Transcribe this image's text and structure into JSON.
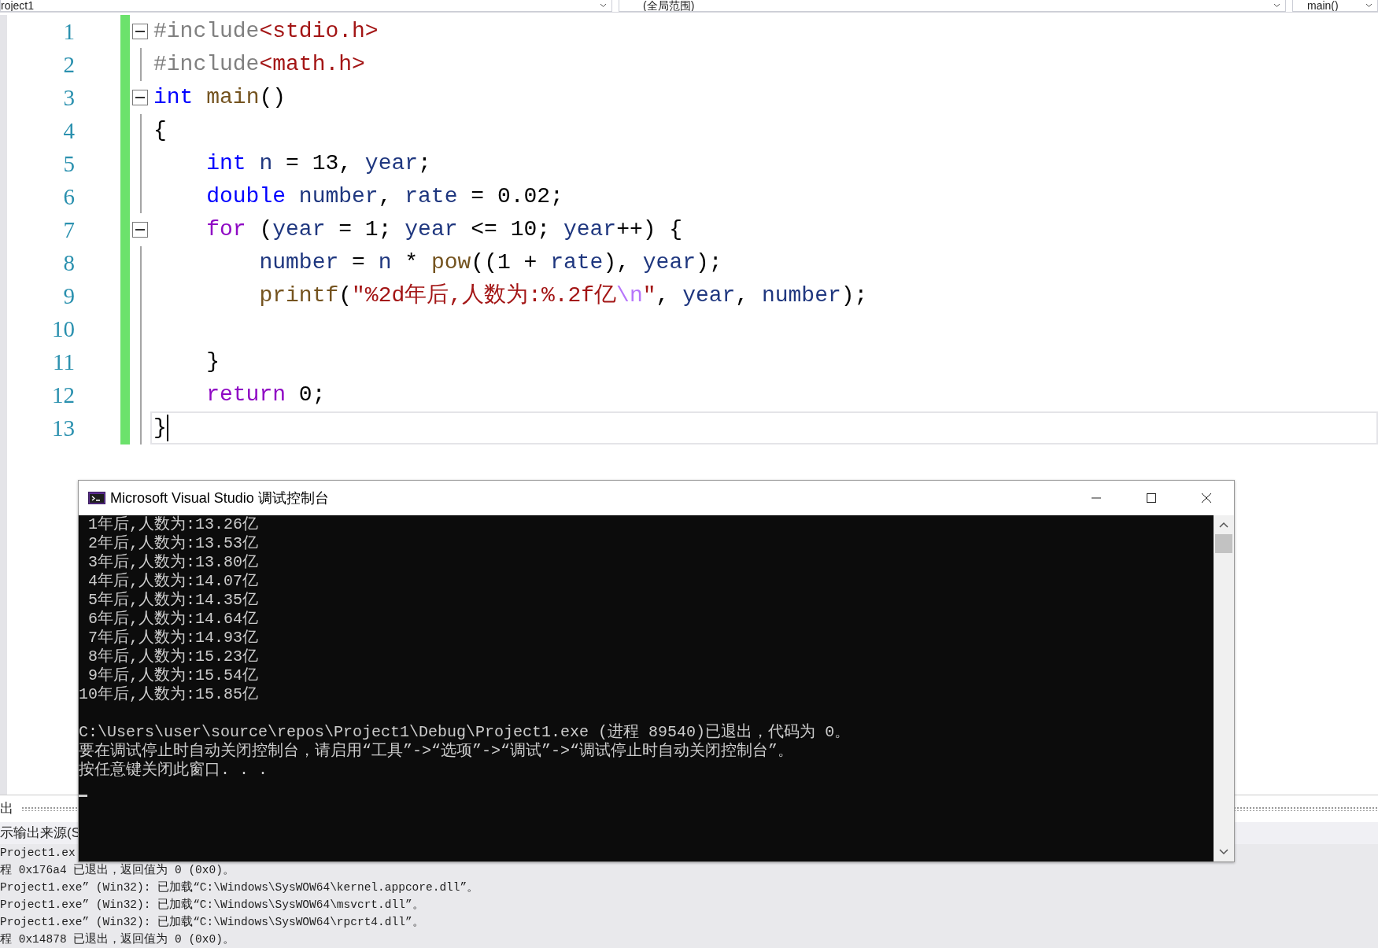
{
  "toolbar": {
    "dropdowns": [
      "roject1",
      "(全局范围)",
      "main()"
    ]
  },
  "editor": {
    "lines": [
      {
        "number": "1",
        "modified": true,
        "current": false,
        "expanded": true,
        "tokens": [
          {
            "kind": "preproc",
            "text": "#include"
          },
          {
            "kind": "string",
            "text": "<stdio.h>"
          }
        ]
      },
      {
        "number": "2",
        "modified": true,
        "current": false,
        "tokens": [
          {
            "kind": "preproc",
            "text": "#include"
          },
          {
            "kind": "string",
            "text": "<math.h>"
          }
        ]
      },
      {
        "number": "3",
        "modified": true,
        "current": false,
        "expanded": true,
        "tokens": [
          {
            "kind": "keyword",
            "text": "int"
          },
          {
            "kind": "function",
            "text": " main"
          },
          {
            "kind": "plain",
            "text": "()"
          }
        ]
      },
      {
        "number": "4",
        "modified": true,
        "current": false,
        "tokens": [
          {
            "kind": "plain",
            "text": "{"
          }
        ]
      },
      {
        "number": "5",
        "modified": true,
        "current": false,
        "tokens": [
          {
            "kind": "keyword",
            "text": "    int"
          },
          {
            "kind": "variable",
            "text": " n"
          },
          {
            "kind": "plain",
            "text": " = 13, "
          },
          {
            "kind": "variable",
            "text": "year"
          },
          {
            "kind": "plain",
            "text": ";"
          }
        ]
      },
      {
        "number": "6",
        "modified": true,
        "current": false,
        "tokens": [
          {
            "kind": "keyword",
            "text": "    double"
          },
          {
            "kind": "variable",
            "text": " number"
          },
          {
            "kind": "plain",
            "text": ", "
          },
          {
            "kind": "variable",
            "text": "rate"
          },
          {
            "kind": "plain",
            "text": " = 0.02;"
          }
        ]
      },
      {
        "number": "7",
        "modified": true,
        "current": false,
        "expanded": true,
        "tokens": [
          {
            "kind": "control",
            "text": "    for"
          },
          {
            "kind": "plain",
            "text": " ("
          },
          {
            "kind": "variable",
            "text": "year"
          },
          {
            "kind": "plain",
            "text": " = 1; "
          },
          {
            "kind": "variable",
            "text": "year"
          },
          {
            "kind": "plain",
            "text": " <= 10; "
          },
          {
            "kind": "variable",
            "text": "year"
          },
          {
            "kind": "plain",
            "text": "++) {"
          }
        ]
      },
      {
        "number": "8",
        "modified": true,
        "current": false,
        "tokens": [
          {
            "kind": "variable",
            "text": "        number"
          },
          {
            "kind": "plain",
            "text": " = "
          },
          {
            "kind": "variable",
            "text": "n"
          },
          {
            "kind": "plain",
            "text": " * "
          },
          {
            "kind": "function",
            "text": "pow"
          },
          {
            "kind": "plain",
            "text": "((1 + "
          },
          {
            "kind": "variable",
            "text": "rate"
          },
          {
            "kind": "plain",
            "text": "), "
          },
          {
            "kind": "variable",
            "text": "year"
          },
          {
            "kind": "plain",
            "text": ");"
          }
        ]
      },
      {
        "number": "9",
        "modified": true,
        "current": false,
        "tokens": [
          {
            "kind": "function",
            "text": "        printf"
          },
          {
            "kind": "plain",
            "text": "("
          },
          {
            "kind": "string",
            "text": "\"%2d年后,人数为:%.2f亿"
          },
          {
            "kind": "escape",
            "text": "\\n"
          },
          {
            "kind": "string",
            "text": "\""
          },
          {
            "kind": "plain",
            "text": ", "
          },
          {
            "kind": "variable",
            "text": "year"
          },
          {
            "kind": "plain",
            "text": ", "
          },
          {
            "kind": "variable",
            "text": "number"
          },
          {
            "kind": "plain",
            "text": ");"
          }
        ]
      },
      {
        "number": "10",
        "modified": true,
        "current": false
      },
      {
        "number": "11",
        "modified": true,
        "current": false,
        "tokens": [
          {
            "kind": "plain",
            "text": "    }"
          }
        ]
      },
      {
        "number": "12",
        "modified": true,
        "current": false,
        "tokens": [
          {
            "kind": "control",
            "text": "    return"
          },
          {
            "kind": "plain",
            "text": " 0;"
          }
        ]
      },
      {
        "number": "13",
        "modified": true,
        "current": true,
        "tokens": [
          {
            "kind": "plain",
            "text": "}"
          }
        ]
      }
    ]
  },
  "console": {
    "title": "Microsoft Visual Studio 调试控制台",
    "results": [
      " 1年后,人数为:13.26亿",
      " 2年后,人数为:13.53亿",
      " 3年后,人数为:13.80亿",
      " 4年后,人数为:14.07亿",
      " 5年后,人数为:14.35亿",
      " 6年后,人数为:14.64亿",
      " 7年后,人数为:14.93亿",
      " 8年后,人数为:15.23亿",
      " 9年后,人数为:15.54亿",
      "10年后,人数为:15.85亿"
    ],
    "messages": [
      "C:\\Users\\user\\source\\repos\\Project1\\Debug\\Project1.exe (进程 89540)已退出，代码为 0。",
      "要在调试停止时自动关闭控制台，请启用“工具”->“选项”->“调试”->“调试停止时自动关闭控制台”。",
      "按任意键关闭此窗口. . ."
    ]
  },
  "output_panel": {
    "tab": "出",
    "source_label": "示输出来源(S",
    "lines": [
      "Project1.ex",
      "程 0x176a4 已退出，返回值为 0 (0x0)。",
      "Project1.exe” (Win32): 已加载“C:\\Windows\\SysWOW64\\kernel.appcore.dll”。",
      "Project1.exe” (Win32): 已加载“C:\\Windows\\SysWOW64\\msvcrt.dll”。",
      "Project1.exe” (Win32): 已加载“C:\\Windows\\SysWOW64\\rpcrt4.dll”。",
      "程 0x14878 已退出，返回值为 0 (0x0)。"
    ]
  }
}
